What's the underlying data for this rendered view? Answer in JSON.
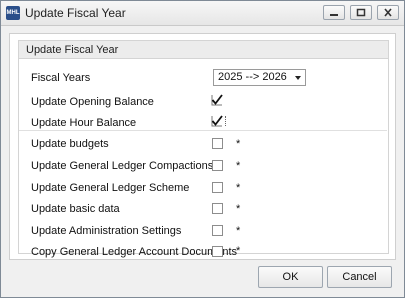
{
  "window": {
    "title": "Update Fiscal Year",
    "icon_text": "MHL",
    "controls": [
      "minimize-icon",
      "maximize-icon",
      "close-icon"
    ]
  },
  "group": {
    "title": "Update Fiscal Year"
  },
  "fiscal_years": {
    "label": "Fiscal Years",
    "value": "2025 --> 2026"
  },
  "rows": {
    "opening_balance": {
      "label": "Update Opening Balance",
      "checked": true
    },
    "hour_balance": {
      "label": "Update Hour Balance",
      "checked": true
    },
    "budgets": {
      "label": "Update budgets",
      "checked": false,
      "marker": "*"
    },
    "gl_compactions": {
      "label": "Update General Ledger Compactions",
      "checked": false,
      "marker": "*"
    },
    "gl_scheme": {
      "label": "Update General Ledger Scheme",
      "checked": false,
      "marker": "*"
    },
    "basic_data": {
      "label": "Update basic data",
      "checked": false,
      "marker": "*"
    },
    "admin_settings": {
      "label": "Update Administration Settings",
      "checked": false,
      "marker": "*"
    },
    "gl_account_documents": {
      "label": "Copy General Ledger Account Documents",
      "checked": false,
      "marker": "*"
    }
  },
  "buttons": {
    "ok": "OK",
    "cancel": "Cancel"
  }
}
